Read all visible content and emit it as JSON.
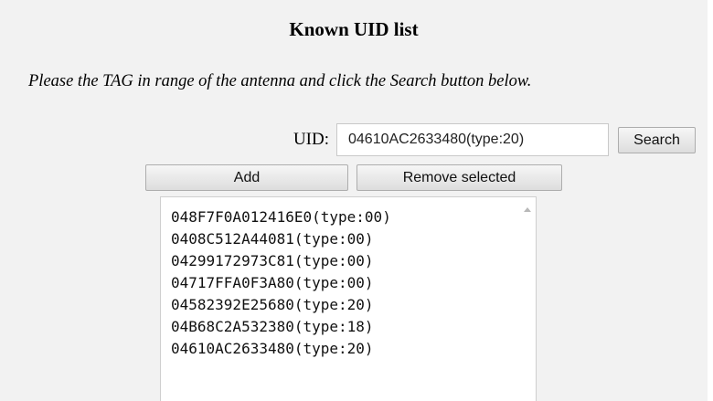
{
  "title": "Known UID list",
  "instructions": "Please the TAG in range of the antenna and click the Search button below.",
  "uid_field": {
    "label": "UID:",
    "value": "04610AC2633480(type:20)"
  },
  "buttons": {
    "search": "Search",
    "add": "Add",
    "remove_selected": "Remove selected"
  },
  "uid_list": [
    "048F7F0A012416E0(type:00)",
    "0408C512A44081(type:00)",
    "04299172973C81(type:00)",
    "04717FFA0F3A80(type:00)",
    "04582392E25680(type:20)",
    "04B68C2A532380(type:18)",
    "04610AC2633480(type:20)"
  ],
  "icons": {
    "scroll_up": "scroll-up-arrow-icon"
  }
}
